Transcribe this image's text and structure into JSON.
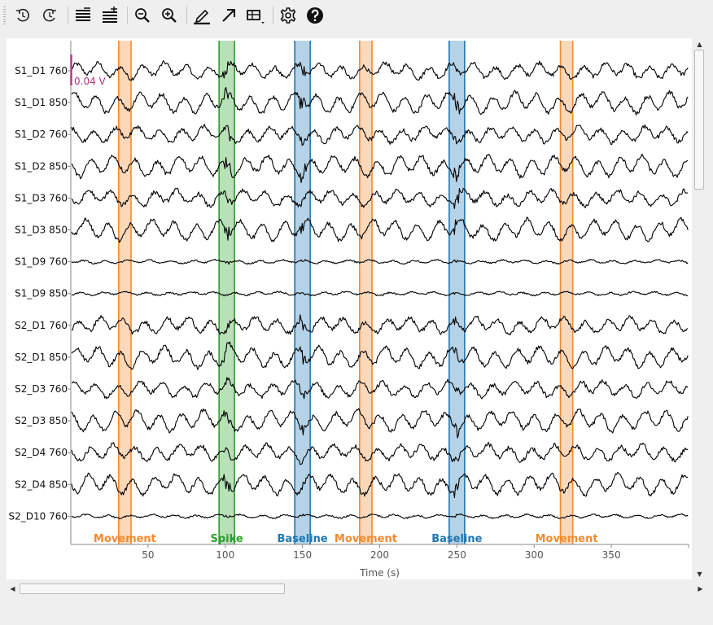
{
  "toolbar": {
    "buttons": [
      {
        "name": "rewind-icon",
        "title": "Time back"
      },
      {
        "name": "forward-icon",
        "title": "Time forward"
      },
      {
        "name": "fewer-channels-icon",
        "title": "Fewer channels"
      },
      {
        "name": "more-channels-icon",
        "title": "More channels"
      },
      {
        "name": "zoom-out-icon",
        "title": "Zoom out"
      },
      {
        "name": "zoom-in-icon",
        "title": "Zoom in"
      },
      {
        "name": "annotate-pen-icon",
        "title": "Annotation mode"
      },
      {
        "name": "arrow-icon",
        "title": "Jump"
      },
      {
        "name": "projector-icon",
        "title": "Projectors"
      },
      {
        "name": "gear-icon",
        "title": "Settings"
      },
      {
        "name": "help-icon",
        "title": "Help"
      }
    ]
  },
  "plot": {
    "channels": [
      "S1_D1 760",
      "S1_D1 850",
      "S1_D2 760",
      "S1_D2 850",
      "S1_D3 760",
      "S1_D3 850",
      "S1_D9 760",
      "S1_D9 850",
      "S2_D1 760",
      "S2_D1 850",
      "S2_D3 760",
      "S2_D3 850",
      "S2_D4 760",
      "S2_D4 850",
      "S2_D10 760"
    ],
    "scale_label": "0.04 V",
    "xlabel": "Time (s)",
    "x_ticks": [
      50,
      100,
      150,
      200,
      250,
      300,
      350
    ],
    "x_range": [
      0,
      400
    ],
    "colors": {
      "Movement": "#f28a2e",
      "Spike": "#2ca02c",
      "Baseline": "#1f77b4",
      "scale": "#b0337f"
    },
    "annotations": [
      {
        "label": "Movement",
        "start": 31,
        "end": 39
      },
      {
        "label": "Spike",
        "start": 96,
        "end": 106
      },
      {
        "label": "Baseline",
        "start": 145,
        "end": 155
      },
      {
        "label": "Movement",
        "start": 187,
        "end": 195
      },
      {
        "label": "Baseline",
        "start": 245,
        "end": 255
      },
      {
        "label": "Movement",
        "start": 317,
        "end": 325
      }
    ]
  }
}
